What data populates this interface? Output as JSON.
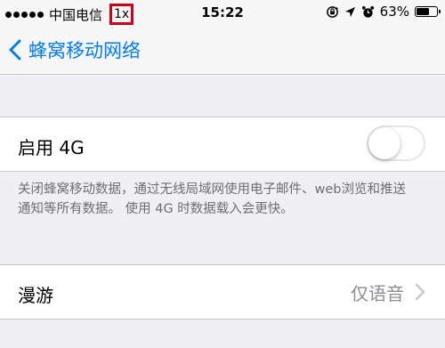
{
  "status_bar": {
    "carrier": "中国电信",
    "network_type": "1x",
    "time": "15:22",
    "battery_percent": "63%",
    "battery_level": 0.63,
    "icons": [
      "signal-dots-icon",
      "lock-rotation-icon",
      "location-arrow-icon",
      "alarm-icon",
      "battery-icon"
    ],
    "highlight_color": "#d0021b"
  },
  "nav": {
    "back_label": "蜂窝移动网络",
    "accent_color": "#007aff"
  },
  "settings": {
    "enable_4g": {
      "label": "启用 4G",
      "on": false
    },
    "footnote": "关闭蜂窝移动数据，通过无线局域网使用电子邮件、web浏览和推送通知等所有数据。 使用 4G 时数据载入会更快。",
    "roaming": {
      "label": "漫游",
      "value": "仅语音"
    }
  }
}
